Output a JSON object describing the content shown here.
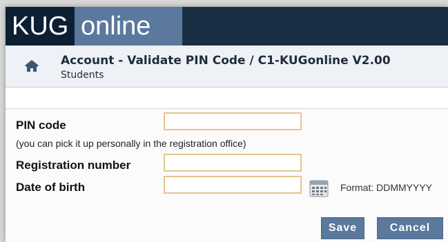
{
  "header": {
    "logo_part1": "KUG",
    "logo_part2": "online"
  },
  "titlebar": {
    "title": "Account - Validate PIN Code  / C1-KUGonline V2.00",
    "subtitle": "Students"
  },
  "form": {
    "pin_label": "PIN code",
    "pin_hint": "(you can pick it up personally in the registration office)",
    "pin_value": "",
    "regnum_label": "Registration number",
    "regnum_value": "",
    "dob_label": "Date of birth",
    "dob_value": "",
    "dob_format": "Format: DDMMYYYY"
  },
  "buttons": {
    "save": "Save",
    "cancel": "Cancel"
  },
  "colors": {
    "accent": "#5b789d",
    "topbar": "#1a2f44",
    "field_border": "#e7c48c"
  },
  "icons": {
    "home": "home-icon",
    "calendar": "calendar-icon"
  }
}
